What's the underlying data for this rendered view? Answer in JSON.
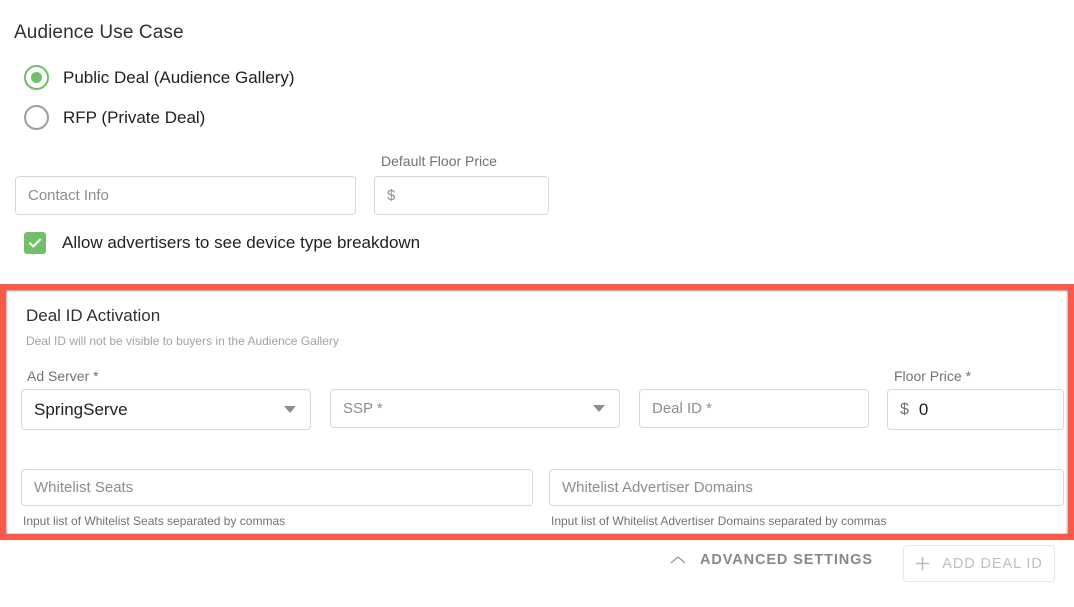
{
  "section": {
    "title": "Audience Use Case"
  },
  "use_case_options": [
    {
      "label": "Public Deal (Audience Gallery)",
      "selected": true
    },
    {
      "label": "RFP (Private Deal)",
      "selected": false
    }
  ],
  "contact_info": {
    "placeholder": "Contact Info",
    "value": ""
  },
  "default_floor_price": {
    "label": "Default Floor Price",
    "currency_symbol": "$",
    "value": ""
  },
  "device_breakdown": {
    "label": "Allow advertisers to see device type breakdown",
    "checked": true
  },
  "deal_panel": {
    "title": "Deal ID Activation",
    "subtitle": "Deal ID will not be visible to buyers in the Audience Gallery",
    "highlight_color": "#fb5a4b",
    "ad_server": {
      "label": "Ad Server *",
      "value": "SpringServe"
    },
    "ssp": {
      "placeholder": "SSP *",
      "value": ""
    },
    "deal_id": {
      "placeholder": "Deal ID *",
      "value": ""
    },
    "floor_price": {
      "label": "Floor Price *",
      "currency_symbol": "$",
      "value": "0"
    },
    "whitelist_seats": {
      "placeholder": "Whitelist Seats",
      "value": "",
      "hint": "Input list of Whitelist Seats separated by commas"
    },
    "whitelist_advertiser_domains": {
      "placeholder": "Whitelist Advertiser Domains",
      "value": "",
      "hint": "Input list of Whitelist Advertiser Domains separated by commas"
    }
  },
  "footer": {
    "advanced_settings_label": "ADVANCED SETTINGS",
    "add_deal_id_label": "ADD DEAL ID"
  },
  "colors": {
    "accent_green": "#72bf6a",
    "highlight_red": "#fb5a4b",
    "text_primary": "#202124",
    "text_muted": "#8b8e92"
  }
}
